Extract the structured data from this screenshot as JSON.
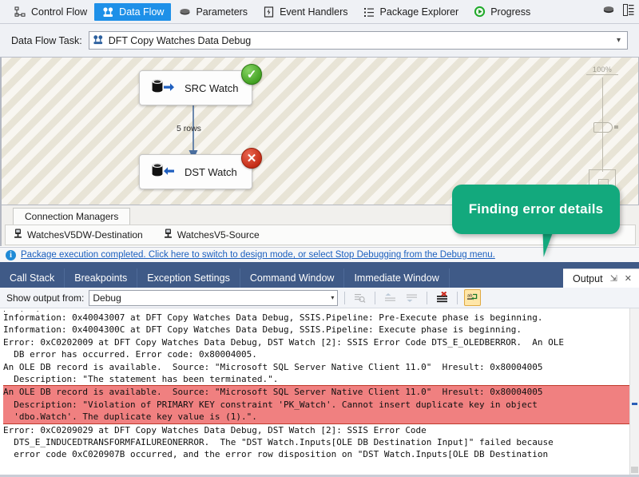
{
  "designer_tabs": [
    {
      "label": "Control Flow",
      "icon": "control-flow-icon",
      "active": false
    },
    {
      "label": "Data Flow",
      "icon": "data-flow-icon",
      "active": true
    },
    {
      "label": "Parameters",
      "icon": "parameters-icon",
      "active": false
    },
    {
      "label": "Event Handlers",
      "icon": "event-handlers-icon",
      "active": false
    },
    {
      "label": "Package Explorer",
      "icon": "package-explorer-icon",
      "active": false
    },
    {
      "label": "Progress",
      "icon": "progress-play-icon",
      "active": false
    }
  ],
  "designer_right_tools": [
    {
      "name": "variables-icon"
    },
    {
      "name": "ssis-toolbox-icon"
    }
  ],
  "data_flow_task": {
    "label": "Data Flow Task:",
    "selected": "DFT Copy Watches Data Debug",
    "icon": "data-flow-icon",
    "caret": "chevron-down-icon"
  },
  "canvas": {
    "zoom_percent": "100%",
    "path_label": "5 rows",
    "nodes": [
      {
        "id": "src",
        "label": "SRC Watch",
        "icon": "ole-db-source-icon",
        "status": "success",
        "status_glyph": "✓"
      },
      {
        "id": "dst",
        "label": "DST Watch",
        "icon": "ole-db-destination-icon",
        "status": "error",
        "status_glyph": "✕"
      }
    ]
  },
  "callout": {
    "text": "Finding error details",
    "color": "#13a97d"
  },
  "connection_managers": {
    "tab_label": "Connection Managers",
    "items": [
      {
        "label": "WatchesV5DW-Destination",
        "icon": "connection-icon"
      },
      {
        "label": "WatchesV5-Source",
        "icon": "connection-icon"
      }
    ]
  },
  "info_bar": {
    "icon": "info-icon",
    "glyph": "i",
    "message": "Package execution completed. Click here to switch to design mode, or select Stop Debugging from the Debug menu.",
    "link_color": "#1b5fbe"
  },
  "dock": {
    "tabs": [
      {
        "label": "Call Stack",
        "active": false
      },
      {
        "label": "Breakpoints",
        "active": false
      },
      {
        "label": "Exception Settings",
        "active": false
      },
      {
        "label": "Command Window",
        "active": false
      },
      {
        "label": "Immediate Window",
        "active": false
      },
      {
        "label": "Output",
        "active": true
      }
    ],
    "active_tab_buttons": [
      {
        "name": "pin-icon",
        "glyph": "⇲"
      },
      {
        "name": "close-icon",
        "glyph": "✕"
      }
    ]
  },
  "output_toolbar": {
    "show_output_from_label": "Show output from:",
    "selected_source": "Debug",
    "caret": "chevron-down-icon",
    "buttons": [
      {
        "name": "find-message-icon",
        "enabled": false
      },
      {
        "name": "go-to-previous-message-icon",
        "enabled": false
      },
      {
        "name": "go-to-next-message-icon",
        "enabled": false
      },
      {
        "name": "clear-all-icon",
        "enabled": true
      },
      {
        "name": "toggle-word-wrap-icon",
        "enabled": true,
        "active": true
      }
    ]
  },
  "output_lines": [
    {
      "text": "beginning.",
      "selected": false,
      "clipped": true
    },
    {
      "text": "Information: 0x40043007 at DFT Copy Watches Data Debug, SSIS.Pipeline: Pre-Execute phase is beginning.",
      "selected": false
    },
    {
      "text": "Information: 0x4004300C at DFT Copy Watches Data Debug, SSIS.Pipeline: Execute phase is beginning.",
      "selected": false
    },
    {
      "text": "Error: 0xC0202009 at DFT Copy Watches Data Debug, DST Watch [2]: SSIS Error Code DTS_E_OLEDBERROR.  An OLE",
      "selected": false
    },
    {
      "text": "  DB error has occurred. Error code: 0x80004005.",
      "selected": false
    },
    {
      "text": "An OLE DB record is available.  Source: \"Microsoft SQL Server Native Client 11.0\"  Hresult: 0x80004005",
      "selected": false
    },
    {
      "text": "  Description: \"The statement has been terminated.\".",
      "selected": false
    },
    {
      "text": "An OLE DB record is available.  Source: \"Microsoft SQL Server Native Client 11.0\"  Hresult: 0x80004005",
      "selected": true
    },
    {
      "text": "  Description: \"Violation of PRIMARY KEY constraint 'PK_Watch'. Cannot insert duplicate key in object",
      "selected": true
    },
    {
      "text": "  'dbo.Watch'. The duplicate key value is (1).\".",
      "selected": true
    },
    {
      "text": "Error: 0xC0209029 at DFT Copy Watches Data Debug, DST Watch [2]: SSIS Error Code",
      "selected": false
    },
    {
      "text": "  DTS_E_INDUCEDTRANSFORMFAILUREONERROR.  The \"DST Watch.Inputs[OLE DB Destination Input]\" failed because",
      "selected": false
    },
    {
      "text": "  error code 0xC020907B occurred, and the error row disposition on \"DST Watch.Inputs[OLE DB Destination",
      "selected": false
    }
  ],
  "colors": {
    "accent_blue": "#1e90e8",
    "dock_blue": "#3f5a87",
    "selection_red": "#f08080",
    "selection_border": "#c0392b",
    "success_green": "#3f9e1f",
    "error_red": "#c22a14",
    "callout_green": "#13a97d"
  }
}
